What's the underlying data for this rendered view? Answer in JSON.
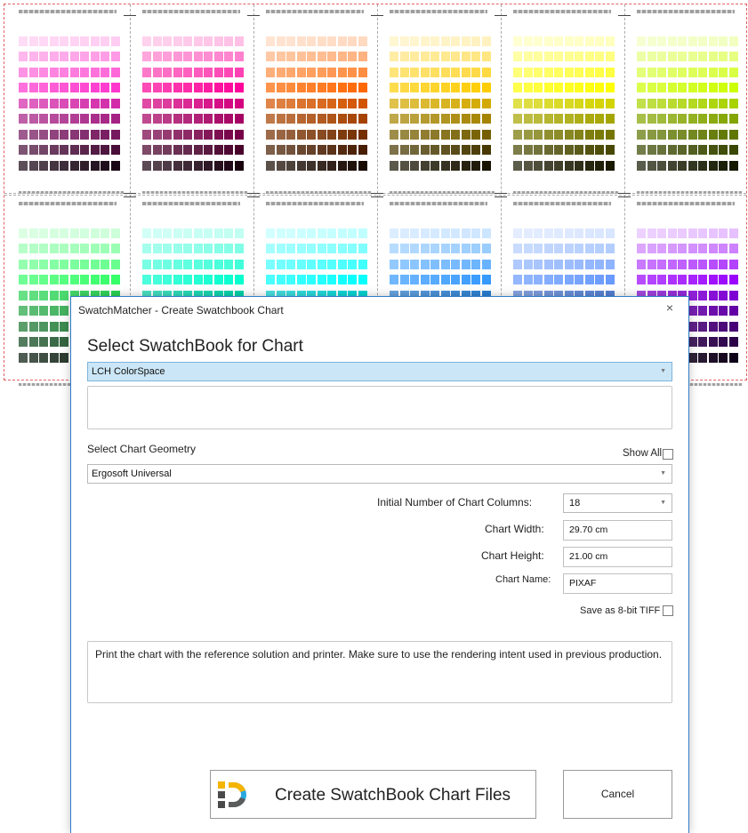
{
  "dialog": {
    "title": "SwatchMatcher - Create Swatchbook Chart",
    "close_glyph": "×",
    "heading": "Select SwatchBook for Chart",
    "swatchbook_value": "LCH ColorSpace",
    "geometry_label": "Select Chart Geometry",
    "show_all_label": "Show All",
    "geometry_value": "Ergosoft Universal",
    "columns_label": "Initial Number of Chart Columns:",
    "columns_value": "18",
    "width_label": "Chart Width:",
    "width_value": "29.70 cm",
    "height_label": "Chart Height:",
    "height_value": "21.00 cm",
    "name_label": "Chart Name:",
    "name_value": "PIXAF",
    "tiff_label": "Save as 8-bit TIFF",
    "instructions": "Print the chart with the reference solution and printer. Make sure to use the rendering intent used in previous production.",
    "create_label": "Create SwatchBook Chart Files",
    "cancel_label": "Cancel",
    "icons": {
      "dropdown": "chevron-down-icon",
      "close": "close-icon",
      "app_logo": "app-logo-icon"
    }
  },
  "chart_preview": {
    "hues_top": [
      "#ff33cc",
      "#ff0099",
      "#ff6600",
      "#ffcc00",
      "#ffff00",
      "#ccff00"
    ],
    "hues_bottom": [
      "#33ff66",
      "#00ffcc",
      "#00ffff",
      "#3399ff",
      "#6699ff",
      "#9900ff"
    ]
  },
  "colors": {
    "accent": "#2f7bc8",
    "selected_bg": "#cbe6f6"
  }
}
